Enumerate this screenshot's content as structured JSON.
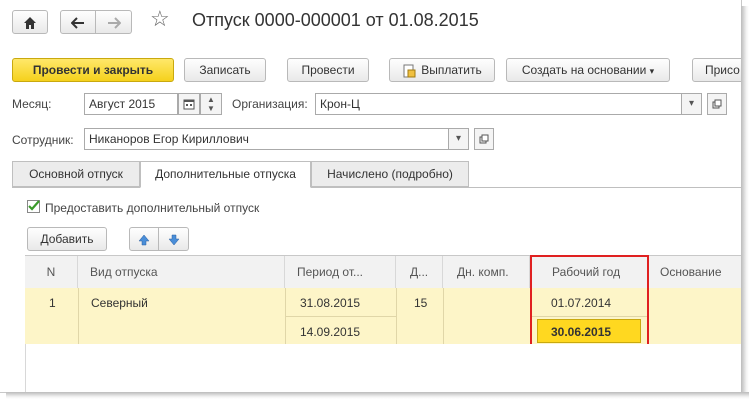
{
  "window": {
    "title": "Отпуск 0000-000001 от 01.08.2015"
  },
  "toolbar": {
    "post_close": "Провести и закрыть",
    "save": "Записать",
    "post": "Провести",
    "pay": "Выплатить",
    "create_based": "Создать на основании",
    "more_truncated": "Присо"
  },
  "form": {
    "month_label": "Месяц:",
    "month_value": "Август 2015",
    "org_label": "Организация:",
    "org_value": "Крон-Ц",
    "employee_label": "Сотрудник:",
    "employee_value": "Никаноров Егор Кириллович"
  },
  "tabs": [
    {
      "label": "Основной отпуск"
    },
    {
      "label": "Дополнительные отпуска"
    },
    {
      "label": "Начислено (подробно)"
    }
  ],
  "additional": {
    "checkbox_label": "Предоставить дополнительный отпуск",
    "checkbox_checked": true,
    "add_button": "Добавить"
  },
  "table": {
    "columns": [
      "N",
      "Вид отпуска",
      "Период от...",
      "Д...",
      "Дн. комп.",
      "Рабочий год",
      "Основание"
    ],
    "rows": [
      {
        "n": "1",
        "type": "Северный",
        "period_from": "31.08.2015",
        "period_to": "14.09.2015",
        "days": "15",
        "comp_days": "",
        "work_year_from": "01.07.2014",
        "work_year_to": "30.06.2015",
        "basis": ""
      }
    ]
  },
  "colors": {
    "accent_yellow": "#f5d11c",
    "row_highlight": "#fdf5c8",
    "selected_cell": "#ffd820",
    "annotation_red": "#e02020"
  }
}
